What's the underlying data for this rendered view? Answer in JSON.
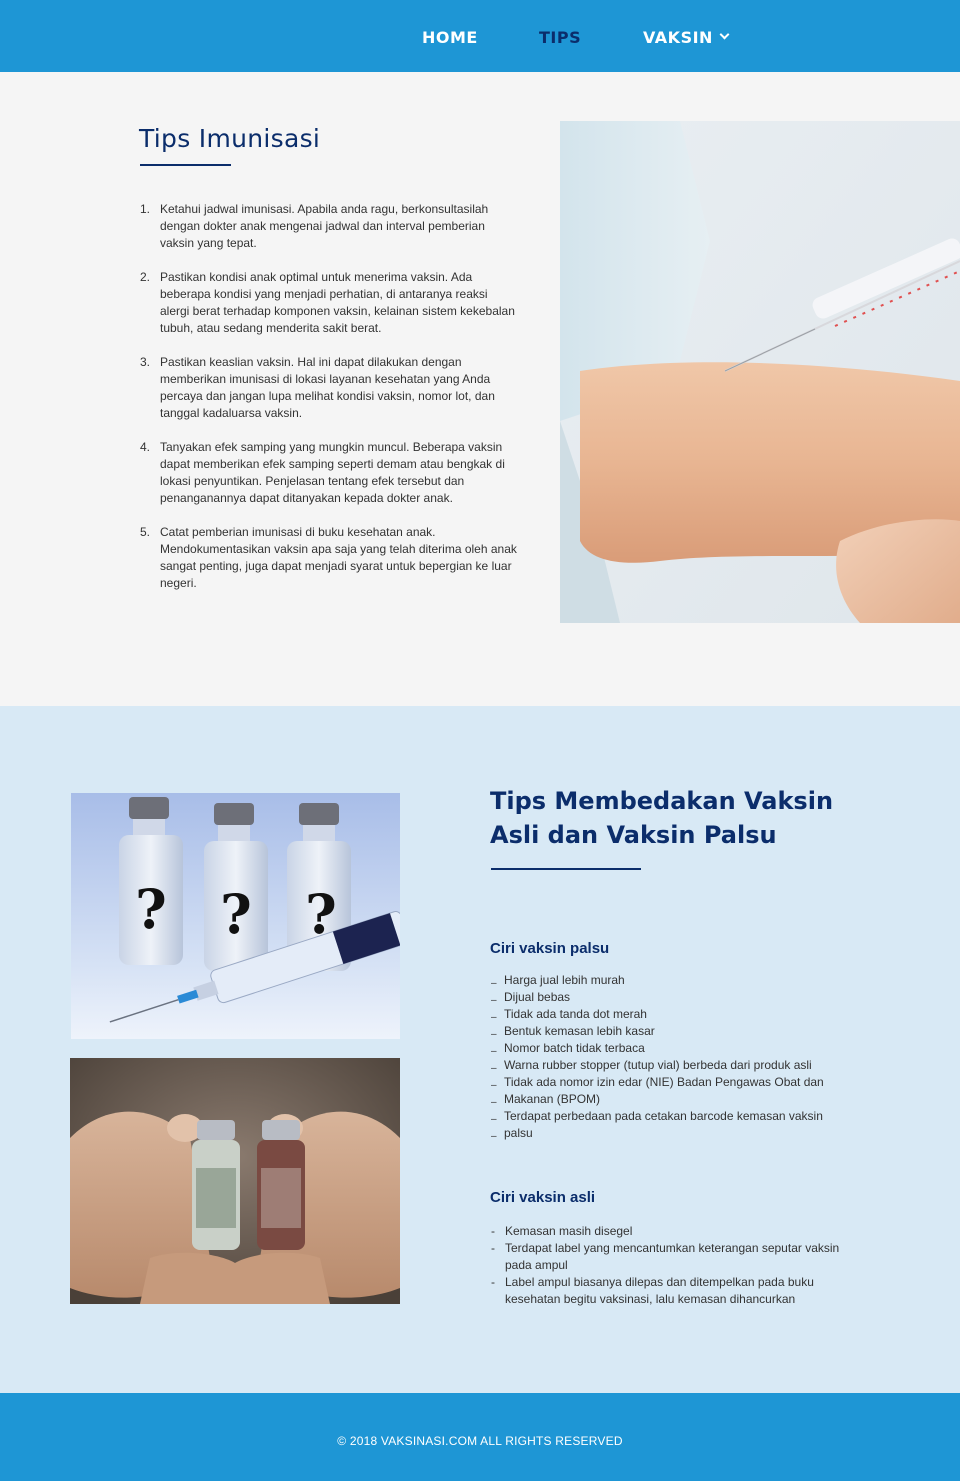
{
  "nav": {
    "home_label": "HOME",
    "tips_label": "TIPS",
    "vaksin_label": "VAKSIN",
    "active_color": "#0b2d6b",
    "bg_color": "#1e96d5"
  },
  "tips_imunisasi": {
    "title": "Tips Imunisasi",
    "items": [
      {
        "num": "1.",
        "text": "Ketahui jadwal imunisasi. Apabila anda ragu, berkonsultasilah dengan dokter anak mengenai jadwal dan interval pemberian vaksin yang tepat."
      },
      {
        "num": "2.",
        "text": "Pastikan kondisi anak optimal untuk menerima vaksin. Ada beberapa kondisi yang menjadi perhatian, di antaranya reaksi alergi berat terhadap komponen vaksin, kelainan sistem kekebalan tubuh, atau sedang menderita sakit berat."
      },
      {
        "num": "3.",
        "text": "Pastikan keaslian vaksin. Hal ini dapat dilakukan dengan memberikan imunisasi di lokasi layanan kesehatan yang Anda percaya dan jangan lupa melihat kondisi vaksin, nomor lot, dan tanggal kadaluarsa vaksin."
      },
      {
        "num": "4.",
        "text": "Tanyakan efek samping yang mungkin muncul. Beberapa vaksin dapat memberikan efek samping seperti demam atau bengkak di lokasi penyuntikan. Penjelasan tentang efek tersebut dan penanganannya dapat ditanyakan kepada dokter anak."
      },
      {
        "num": "5.",
        "text": "Catat pemberian imunisasi di buku kesehatan anak. Mendokumentasikan vaksin apa saja yang telah diterima oleh anak sangat penting, juga dapat menjadi syarat untuk bepergian ke luar negeri."
      }
    ]
  },
  "vaksin_section": {
    "title": "Tips Membedakan Vaksin Asli dan Vaksin Palsu",
    "palsu_heading": "Ciri vaksin palsu",
    "palsu_items": [
      "Harga jual lebih murah",
      "Dijual bebas",
      "Tidak ada tanda dot merah",
      "Bentuk kemasan lebih kasar",
      "Nomor batch tidak terbaca",
      "Warna rubber stopper (tutup vial) berbeda dari produk asli",
      "Tidak ada nomor izin edar (NIE) Badan Pengawas Obat dan",
      "Makanan (BPOM)",
      "Terdapat perbedaan pada cetakan barcode kemasan vaksin",
      "palsu"
    ],
    "asli_heading": "Ciri vaksin asli",
    "asli_items": [
      {
        "dash": "-",
        "text": "Kemasan masih disegel"
      },
      {
        "dash": "-",
        "text": "Terdapat label yang mencantumkan keterangan seputar vaksin pada ampul"
      },
      {
        "dash": "-",
        "text": "Label ampul biasanya dilepas dan ditempelkan pada buku kesehatan begitu vaksinasi, lalu kemasan dihancurkan"
      }
    ],
    "vial_label": "?"
  },
  "footer": {
    "copyright": "© 2018 VAKSINASI.COM ALL RIGHTS RESERVED"
  }
}
